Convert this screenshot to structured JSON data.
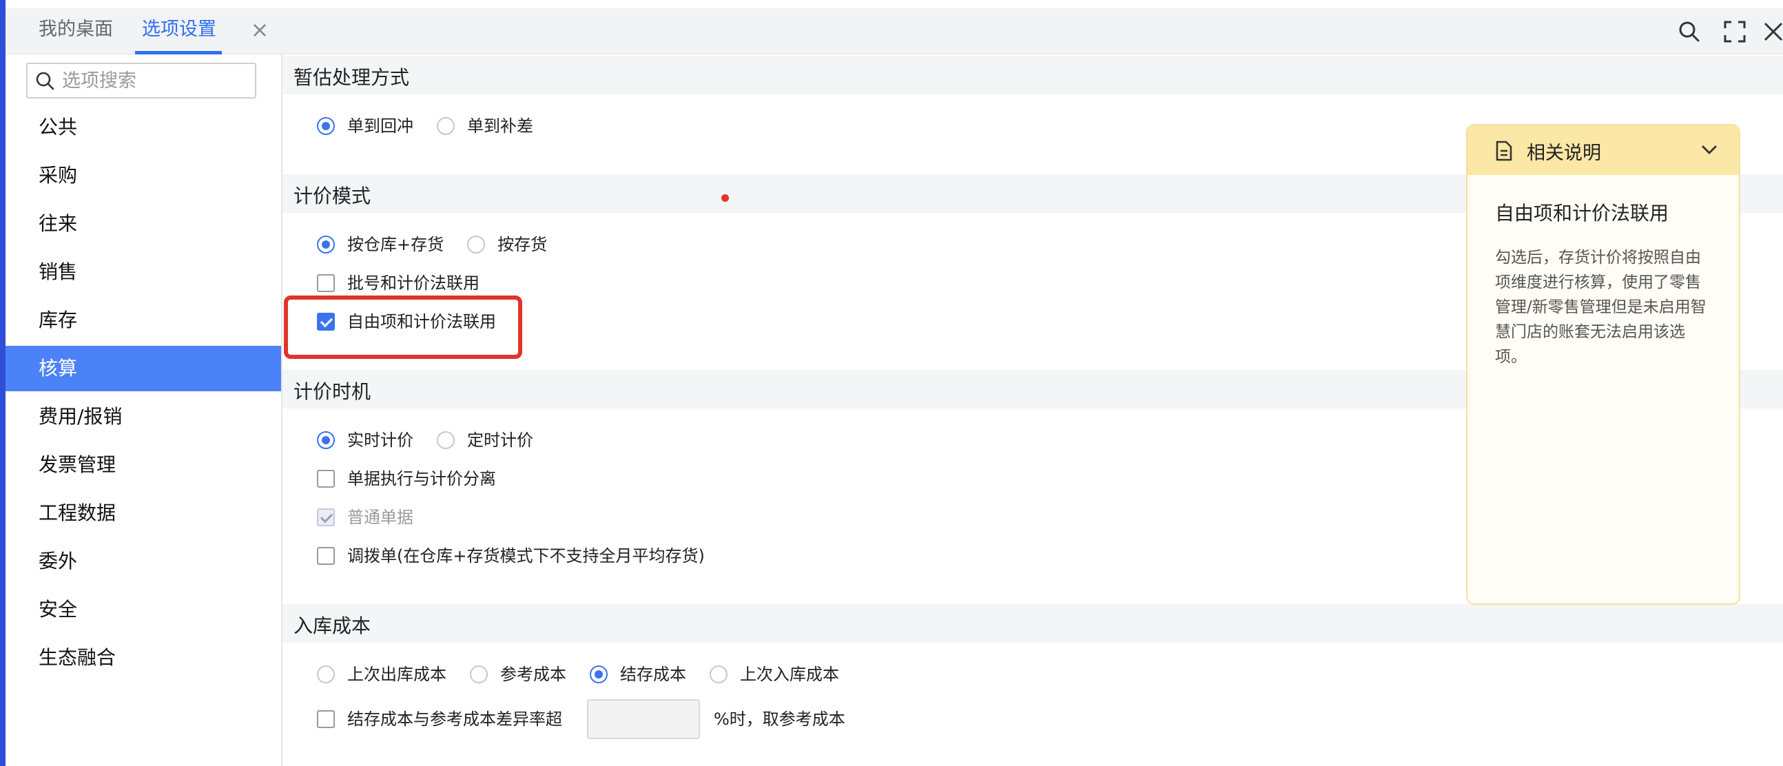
{
  "tabs": {
    "desktop_label": "我的桌面",
    "options_label": "选项设置",
    "close_glyph": "×"
  },
  "sidebar": {
    "search_placeholder": "选项搜索",
    "items": [
      {
        "label": "公共"
      },
      {
        "label": "采购"
      },
      {
        "label": "往来"
      },
      {
        "label": "销售"
      },
      {
        "label": "库存"
      },
      {
        "label": "核算",
        "active": true
      },
      {
        "label": "费用/报销"
      },
      {
        "label": "发票管理"
      },
      {
        "label": "工程数据"
      },
      {
        "label": "委外"
      },
      {
        "label": "安全"
      },
      {
        "label": "生态融合"
      }
    ]
  },
  "main": {
    "estimate": {
      "title": "暂估处理方式",
      "opt1": "单到回冲",
      "opt2": "单到补差",
      "selected": "单到回冲"
    },
    "pricing_mode": {
      "title": "计价模式",
      "opt1": "按仓库+存货",
      "opt2": "按存货",
      "selected": "按仓库+存货",
      "batch_label": "批号和计价法联用",
      "batch_checked": false,
      "free_label": "自由项和计价法联用",
      "free_checked": true
    },
    "pricing_timing": {
      "title": "计价时机",
      "opt1": "实时计价",
      "opt2": "定时计价",
      "selected": "实时计价",
      "separate_label": "单据执行与计价分离",
      "separate_checked": false,
      "normal_label": "普通单据",
      "normal_checked": true,
      "transfer_label": "调拨单(在仓库+存货模式下不支持全月平均存货)",
      "transfer_checked": false
    },
    "inbound_cost": {
      "title": "入库成本",
      "opt1": "上次出库成本",
      "opt2": "参考成本",
      "opt3": "结存成本",
      "opt4": "上次入库成本",
      "selected": "结存成本",
      "diff_label": "结存成本与参考成本差异率超",
      "diff_value": "",
      "diff_suffix": "%时，取参考成本",
      "diff_checked": false
    }
  },
  "help": {
    "title": "相关说明",
    "subtitle": "自由项和计价法联用",
    "text": "勾选后，存货计价将按照自由项维度进行核算，使用了零售管理/新零售管理但是未启用智慧门店的账套无法启用该选项。"
  },
  "colors": {
    "accent": "#2f6ef2",
    "active_nav": "#4c82f7",
    "highlight": "#e0352b",
    "help_header": "#fbe7a6"
  }
}
